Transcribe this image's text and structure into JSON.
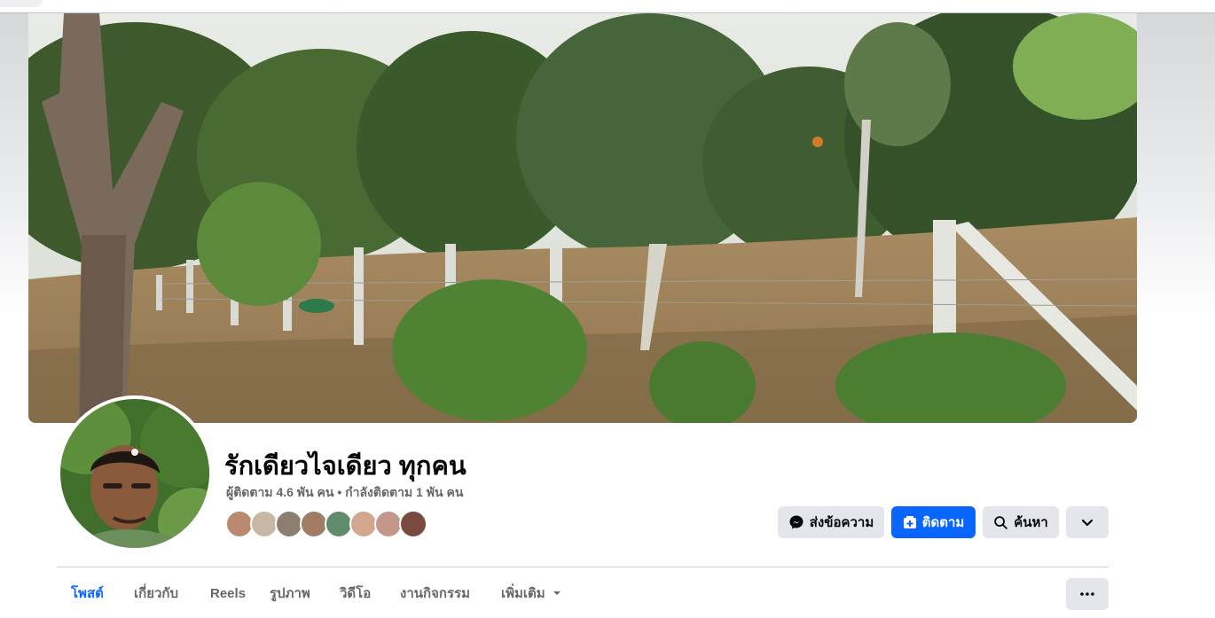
{
  "profile": {
    "name": "รักเดียวไจเดียว ทุกคน",
    "stats": "ผู้ติดตาม 4.6 พัน คน • กำลังติดตาม 1 พัน คน"
  },
  "actions": {
    "message_label": "ส่งข้อความ",
    "follow_label": "ติดตาม",
    "search_label": "ค้นหา"
  },
  "tabs": [
    {
      "label": "โพสต์",
      "active": true
    },
    {
      "label": "เกี่ยวกับ"
    },
    {
      "label": "Reels"
    },
    {
      "label": "รูปภาพ"
    },
    {
      "label": "วิดีโอ"
    },
    {
      "label": "งานกิจกรรม"
    },
    {
      "label": "เพิ่มเติม"
    }
  ],
  "icons": {
    "messenger": "messenger-icon",
    "follow": "follow-icon",
    "search": "search-icon",
    "dropdown": "chevron-down-icon",
    "more": "more-dots-icon"
  },
  "colors": {
    "accent": "#0866ff",
    "button_gray": "#e4e6eb",
    "text_secondary": "#65676b"
  }
}
